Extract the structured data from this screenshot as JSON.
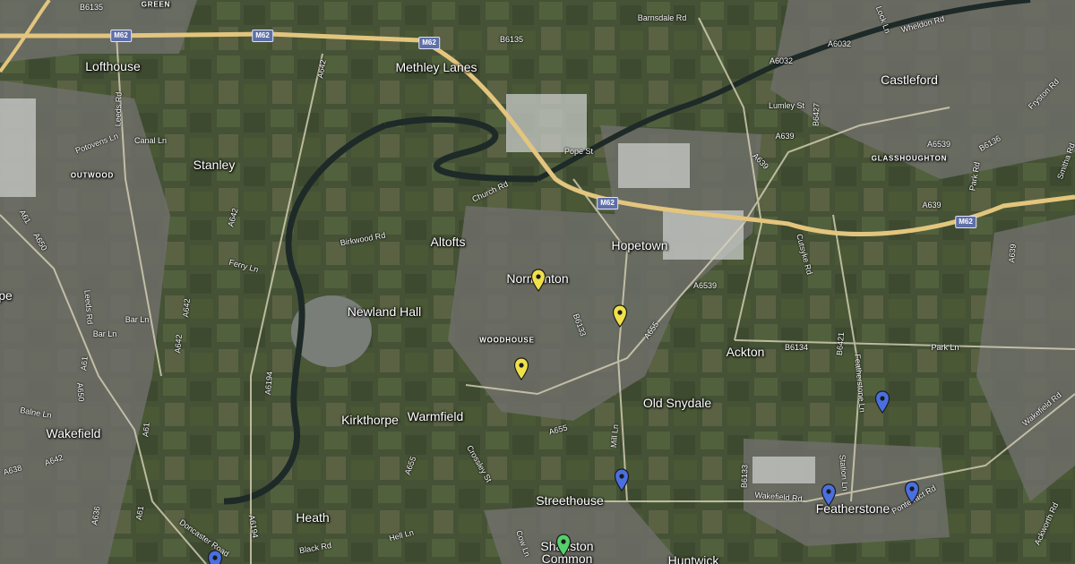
{
  "map": {
    "places": [
      {
        "name": "Lofthouse",
        "style": "big"
      },
      {
        "name": "Methley Lanes",
        "style": "big"
      },
      {
        "name": "Castleford",
        "style": "big"
      },
      {
        "name": "Stanley",
        "style": "big"
      },
      {
        "name": "Altofts",
        "style": "big"
      },
      {
        "name": "Hopetown",
        "style": "big"
      },
      {
        "name": "Normanton",
        "style": "big"
      },
      {
        "name": "Newland Hall",
        "style": "big"
      },
      {
        "name": "Ackton",
        "style": "big"
      },
      {
        "name": "Old Snydale",
        "style": "big"
      },
      {
        "name": "Kirkthorpe",
        "style": "big"
      },
      {
        "name": "Warmfield",
        "style": "big"
      },
      {
        "name": "Wakefield",
        "style": "big"
      },
      {
        "name": "Heath",
        "style": "big"
      },
      {
        "name": "Streethouse",
        "style": "big"
      },
      {
        "name": "Featherstone",
        "style": "big"
      },
      {
        "name": "Sharlston",
        "style": "big"
      },
      {
        "name": "Common",
        "style": "big"
      },
      {
        "name": "Huntwick",
        "style": "big"
      },
      {
        "name": "pe",
        "style": "big"
      },
      {
        "name": "GREEN",
        "style": "caps"
      },
      {
        "name": "OUTWOOD",
        "style": "caps"
      },
      {
        "name": "WOODHOUSE",
        "style": "caps"
      },
      {
        "name": "GLASSHOUGHTON",
        "style": "caps"
      }
    ],
    "roads": [
      "B6135",
      "B6135",
      "Barnsdale Rd",
      "A6032",
      "A6032",
      "Lock Ln",
      "Wheldon Rd",
      "Leeds Rd",
      "A642",
      "Canal Ln",
      "Potovens Ln",
      "Pope St",
      "Lumley St",
      "B6427",
      "A639",
      "A6539",
      "B6136",
      "Park Rd",
      "Fryston Rd",
      "Smitha Rd",
      "A639",
      "Church Rd",
      "Birkwood Rd",
      "A642",
      "Ferry Ln",
      "A61",
      "A650",
      "Leeds Rd",
      "Bar Ln",
      "Bar Ln",
      "A642",
      "A642",
      "A6539",
      "B6133",
      "A655",
      "A639",
      "Cutsyke Rd",
      "B6134",
      "Park Ln",
      "B6421",
      "Featherstone Ln",
      "Wakefield Rd",
      "A61",
      "A650",
      "Balne Ln",
      "A638",
      "A642",
      "A61",
      "A655",
      "Crossley St",
      "A6194",
      "A655",
      "Mill Ln",
      "B6133",
      "Wakefield Rd",
      "Station Ln",
      "Pontefract Rd",
      "A636",
      "A61",
      "Doncaster Road",
      "A6194",
      "Black Rd",
      "Hell Ln",
      "Cow Ln",
      "Ackworth Rd",
      "A639"
    ],
    "motorway_shields": [
      "M62",
      "M62",
      "M62",
      "M62",
      "M62"
    ],
    "pins": [
      {
        "name": "pin-yellow-normanton",
        "color": "#f0e04a"
      },
      {
        "name": "pin-yellow-east",
        "color": "#f0e04a"
      },
      {
        "name": "pin-yellow-woodhouse",
        "color": "#f0e04a"
      },
      {
        "name": "pin-blue-featherstone-ln",
        "color": "#4a6fe0"
      },
      {
        "name": "pin-blue-streethouse",
        "color": "#4a6fe0"
      },
      {
        "name": "pin-blue-featherstone",
        "color": "#4a6fe0"
      },
      {
        "name": "pin-blue-pontefract-rd",
        "color": "#4a6fe0"
      },
      {
        "name": "pin-green-sharlston",
        "color": "#56d06a"
      },
      {
        "name": "pin-blue-wakefield-south",
        "color": "#4a6fe0"
      }
    ],
    "colors": {
      "farmland": "#4d5a3c",
      "urban": "#6d6e66",
      "river": "#1f2a28",
      "motorway": "#e4c680"
    }
  }
}
